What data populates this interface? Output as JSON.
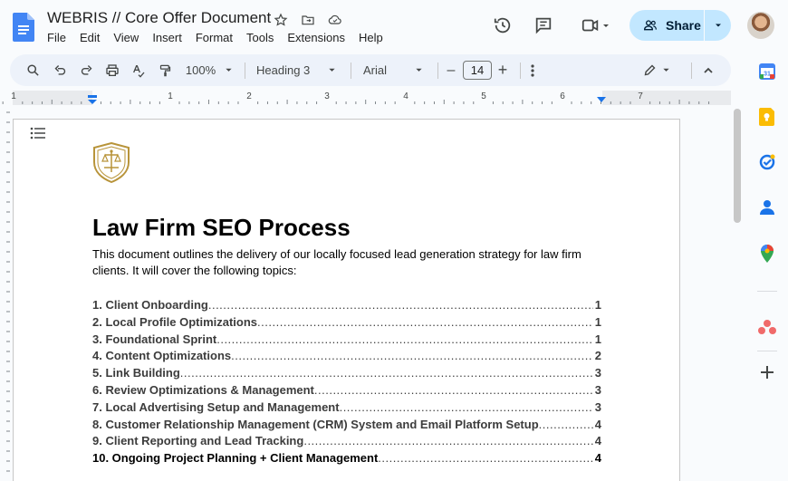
{
  "document": {
    "title": "WEBRIS // Core Offer Document"
  },
  "menu": [
    "File",
    "Edit",
    "View",
    "Insert",
    "Format",
    "Tools",
    "Extensions",
    "Help"
  ],
  "header": {
    "share_label": "Share",
    "icons": [
      "star-icon",
      "move-folder-icon",
      "cloud-status-icon",
      "history-icon",
      "comment-icon",
      "meet-camera-icon"
    ]
  },
  "toolbar": {
    "zoom": "100%",
    "style": "Heading 3",
    "font": "Arial",
    "font_size": "14",
    "minus": "–",
    "plus": "+"
  },
  "ruler": {
    "labels": [
      "1",
      "1",
      "2",
      "3",
      "4",
      "5",
      "6",
      "7"
    ]
  },
  "content": {
    "heading": "Law Firm SEO Process",
    "intro": "This document outlines the delivery of our locally focused lead generation strategy for law firm clients. It will cover the following topics:",
    "toc": [
      {
        "title": "1. Client Onboarding",
        "page": "1"
      },
      {
        "title": "2. Local Profile Optimizations",
        "page": "1"
      },
      {
        "title": "3. Foundational Sprint",
        "page": "1"
      },
      {
        "title": "4. Content Optimizations",
        "page": "2"
      },
      {
        "title": "5. Link Building",
        "page": "3"
      },
      {
        "title": "6. Review Optimizations & Management",
        "page": "3"
      },
      {
        "title": "7. Local Advertising Setup and Management",
        "page": "3"
      },
      {
        "title": "8. Customer Relationship Management (CRM) System and Email Platform Setup",
        "page": "4"
      },
      {
        "title": "9. Client Reporting and Lead Tracking",
        "page": "4"
      },
      {
        "title": "10. Ongoing Project Planning + Client Management",
        "page": "4"
      }
    ]
  },
  "side_panel": [
    "calendar-icon",
    "keep-icon",
    "tasks-icon",
    "contacts-icon",
    "maps-icon",
    "asana-icon",
    "add-icon"
  ],
  "colors": {
    "docs_blue": "#4285f4",
    "share_bg": "#c2e7ff",
    "toolbar_bg": "#edf2fa",
    "page_bg": "#ffffff",
    "logo_gold": "#b8943a"
  }
}
